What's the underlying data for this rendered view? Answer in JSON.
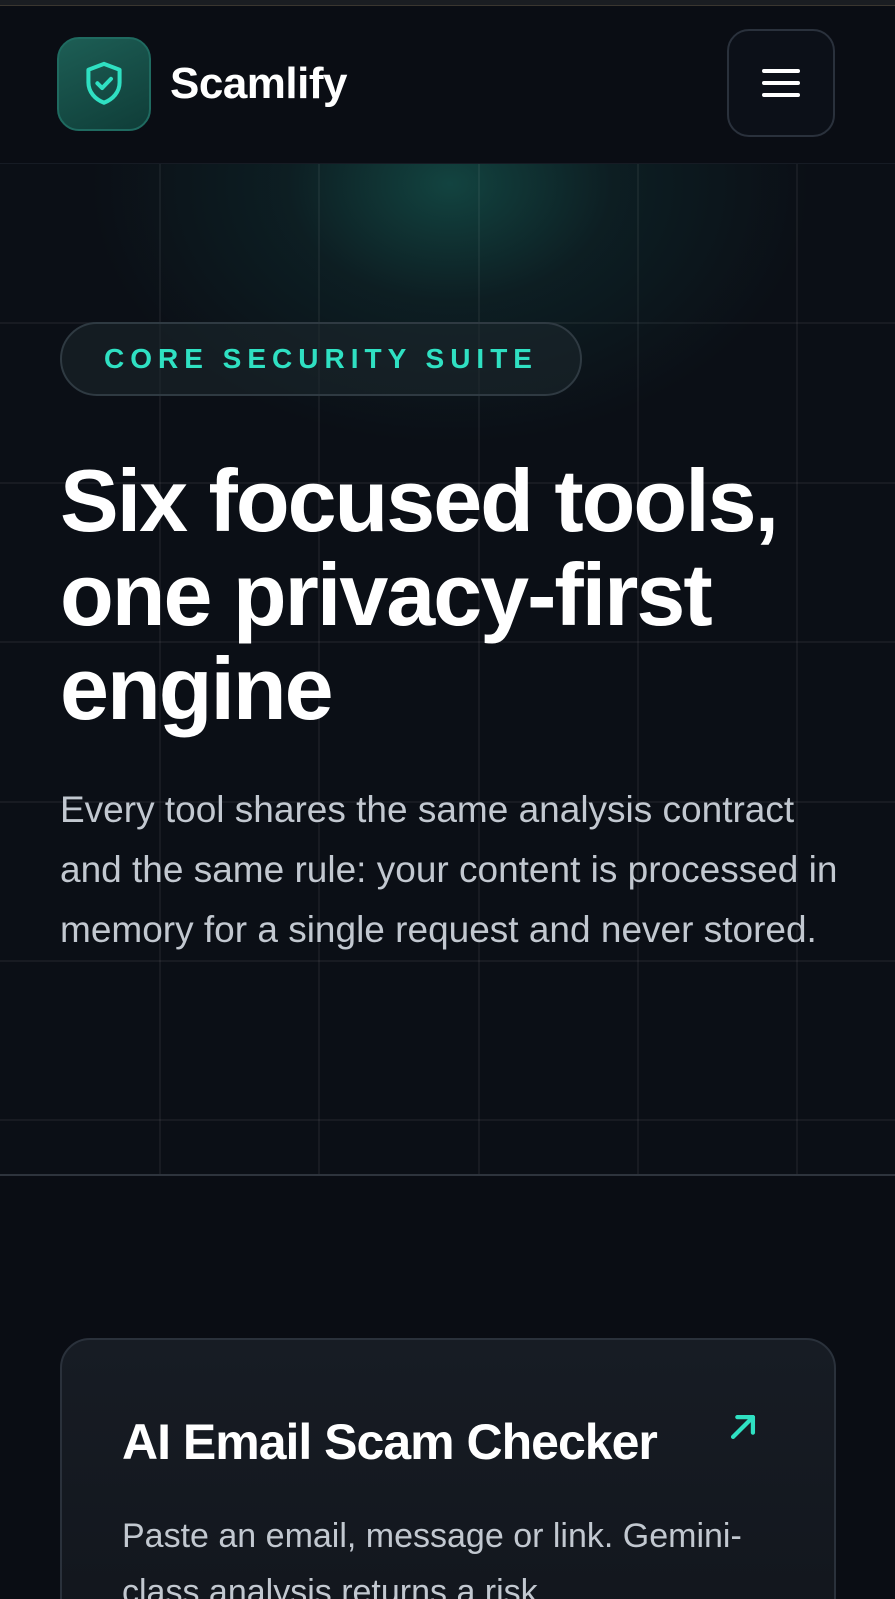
{
  "header": {
    "brand_name": "Scamlify",
    "logo_icon": "shield-check-icon",
    "menu_icon": "hamburger-menu-icon"
  },
  "hero": {
    "eyebrow": "CORE SECURITY SUITE",
    "title": "Six focused tools, one privacy-first engine",
    "description": "Every tool shares the same analysis contract and the same rule: your content is processed in memory for a single request and never stored."
  },
  "tools": [
    {
      "title": "AI Email Scam Checker",
      "description": "Paste an email, message or link. Gemini-class analysis returns a risk",
      "link_icon": "arrow-up-right-icon"
    }
  ],
  "colors": {
    "accent": "#2fe0c2",
    "background": "#0a0d14",
    "logo_badge": "#1d5e55",
    "muted_text": "#c2c8d0"
  }
}
